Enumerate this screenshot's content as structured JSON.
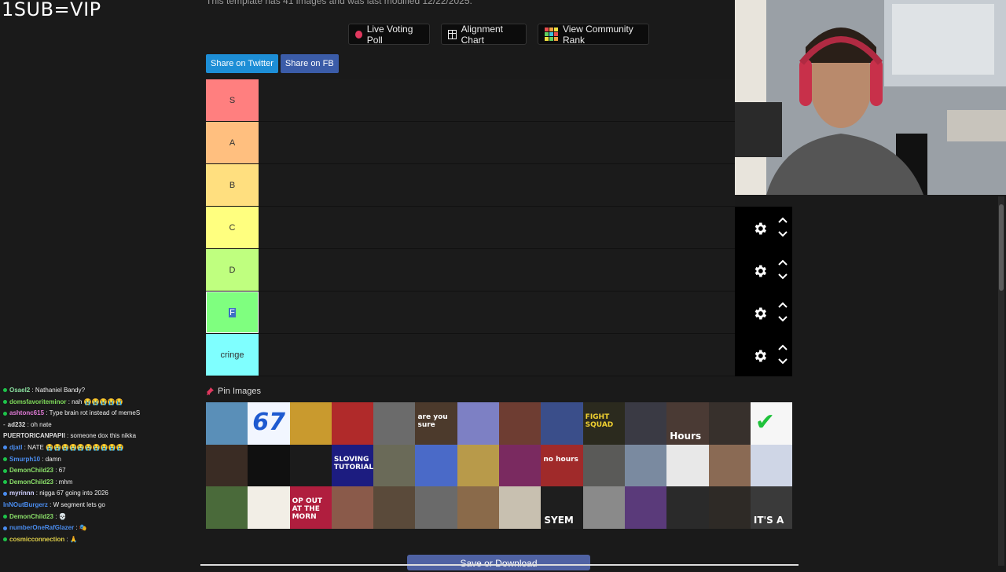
{
  "overlay": {
    "title": "1SUB=VIP"
  },
  "page": {
    "subtitle": "This template has 41 images and was last modified 12/22/2025."
  },
  "toolbar": {
    "live_voting_poll": "Live Voting Poll",
    "alignment_chart": "Alignment Chart",
    "view_community_rank": "View Community Rank"
  },
  "share": {
    "twitter": "Share on Twitter",
    "fb": "Share on FB"
  },
  "tiers": [
    {
      "label": "S",
      "color": "#ff7f7f"
    },
    {
      "label": "A",
      "color": "#ffbf7f"
    },
    {
      "label": "B",
      "color": "#ffdf7f"
    },
    {
      "label": "C",
      "color": "#ffff7f"
    },
    {
      "label": "D",
      "color": "#bfff7f"
    },
    {
      "label": "F",
      "color": "#7fff7f"
    },
    {
      "label": "cringe",
      "color": "#7fffff"
    }
  ],
  "pin": {
    "label": "Pin Images"
  },
  "save": {
    "label": "Save or Download"
  },
  "chat": [
    {
      "user": "Osael2",
      "msg": "Nathaniel Bandy?",
      "color": "#8be0a0"
    },
    {
      "user": "domsfavoriteminor",
      "msg": "nah 😭😭😭😭😭",
      "color": "#7fdc5a"
    },
    {
      "user": "ashtonc615",
      "msg": "Type brain rot instead of memeS",
      "color": "#e07ad6"
    },
    {
      "user": "ad232",
      "msg": "oh nate",
      "color": "#dddddd"
    },
    {
      "user": "PUERTORICANPAPII",
      "msg": "someone dox this nikka",
      "color": "#dddddd"
    },
    {
      "user": "djatl",
      "msg": "NATE 😭😭😭😭😭😭😭😭😭😭",
      "color": "#4a8df0"
    },
    {
      "user": "Smurph10",
      "msg": "damn",
      "color": "#4a8df0"
    },
    {
      "user": "DemonChild23",
      "msg": "67",
      "color": "#8be06a"
    },
    {
      "user": "DemonChild23",
      "msg": "mhm",
      "color": "#8be06a"
    },
    {
      "user": "myrinnn",
      "msg": "nigga 67 going into 2026",
      "color": "#d0d0ff"
    },
    {
      "user": "InNOutBurgerz",
      "msg": "W segment lets go",
      "color": "#4a8df0"
    },
    {
      "user": "DemonChild23",
      "msg": "💀",
      "color": "#8be06a"
    },
    {
      "user": "numberOneRafGlazer",
      "msg": "🎭",
      "color": "#4a8df0"
    },
    {
      "user": "cosmicconnection",
      "msg": "🙏",
      "color": "#e0d04a"
    }
  ],
  "thumbs": [
    {
      "bg": "#5a8fb8",
      "text": ""
    },
    {
      "bg": "#f2f6ff",
      "text": "67",
      "tc": "#1e5ad0"
    },
    {
      "bg": "#c99a2e",
      "text": ""
    },
    {
      "bg": "#b02a2a",
      "text": ""
    },
    {
      "bg": "#6b6b6b",
      "text": ""
    },
    {
      "bg": "#4c3a2c",
      "text": "are you sure",
      "tc": "#fff"
    },
    {
      "bg": "#7d80c4",
      "text": ""
    },
    {
      "bg": "#6e3d32",
      "text": ""
    },
    {
      "bg": "#3a4e8a",
      "text": ""
    },
    {
      "bg": "#2b2a1e",
      "text": "FIGHT SQUAD",
      "tc": "#f0d030"
    },
    {
      "bg": "#3a3a44",
      "text": ""
    },
    {
      "bg": "#4a3a34",
      "text": "Hours",
      "tc": "#fff"
    },
    {
      "bg": "#37302c",
      "text": ""
    },
    {
      "bg": "#f6f6f6",
      "text": "✔",
      "tc": "#1fc23b"
    },
    {
      "bg": "#3a2c24",
      "text": ""
    },
    {
      "bg": "#101010",
      "text": ""
    },
    {
      "bg": "#1b1b1b",
      "text": ""
    },
    {
      "bg": "#1c1c80",
      "text": "SLOVING TUTORIAL",
      "tc": "#fff"
    },
    {
      "bg": "#6a6a58",
      "text": ""
    },
    {
      "bg": "#4a6ac8",
      "text": ""
    },
    {
      "bg": "#b89a4a",
      "text": ""
    },
    {
      "bg": "#7a2a60",
      "text": ""
    },
    {
      "bg": "#a02a2a",
      "text": "no hours",
      "tc": "#fff"
    },
    {
      "bg": "#5a5a58",
      "text": ""
    },
    {
      "bg": "#7a8aa0",
      "text": ""
    },
    {
      "bg": "#e8e8e8",
      "text": ""
    },
    {
      "bg": "#8a6a54",
      "text": ""
    },
    {
      "bg": "#cfd6e6",
      "text": ""
    },
    {
      "bg": "#4a6a3a",
      "text": ""
    },
    {
      "bg": "#f2eee6",
      "text": ""
    },
    {
      "bg": "#b01e3e",
      "text": "OP OUT AT THE MORN",
      "tc": "#fff"
    },
    {
      "bg": "#8a5a4a",
      "text": ""
    },
    {
      "bg": "#5a4a3a",
      "text": ""
    },
    {
      "bg": "#6a6a6a",
      "text": ""
    },
    {
      "bg": "#8a6a4a",
      "text": ""
    },
    {
      "bg": "#c8c0b0",
      "text": ""
    },
    {
      "bg": "#1e1e1e",
      "text": "SYEM",
      "tc": "#fff"
    },
    {
      "bg": "#8a8a8a",
      "text": ""
    },
    {
      "bg": "#5a3a7a",
      "text": ""
    },
    {
      "bg": "#2a2a2a",
      "text": ""
    },
    {
      "bg": "#2e2a26",
      "text": ""
    },
    {
      "bg": "#3a3a3a",
      "text": "IT'S A",
      "tc": "#fff"
    }
  ],
  "colors": {
    "accent": "#3d6fc4",
    "twitter": "#1d8ed6",
    "facebook": "#3b5ca8"
  }
}
